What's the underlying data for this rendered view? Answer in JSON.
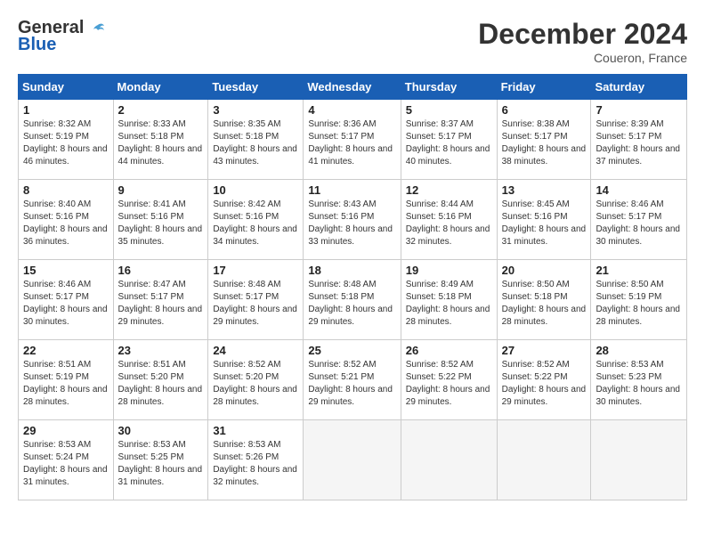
{
  "header": {
    "logo_line1": "General",
    "logo_line2": "Blue",
    "month_title": "December 2024",
    "location": "Coueron, France"
  },
  "days_of_week": [
    "Sunday",
    "Monday",
    "Tuesday",
    "Wednesday",
    "Thursday",
    "Friday",
    "Saturday"
  ],
  "weeks": [
    [
      {
        "day": "1",
        "sunrise": "8:32 AM",
        "sunset": "5:19 PM",
        "daylight": "8 hours and 46 minutes."
      },
      {
        "day": "2",
        "sunrise": "8:33 AM",
        "sunset": "5:18 PM",
        "daylight": "8 hours and 44 minutes."
      },
      {
        "day": "3",
        "sunrise": "8:35 AM",
        "sunset": "5:18 PM",
        "daylight": "8 hours and 43 minutes."
      },
      {
        "day": "4",
        "sunrise": "8:36 AM",
        "sunset": "5:17 PM",
        "daylight": "8 hours and 41 minutes."
      },
      {
        "day": "5",
        "sunrise": "8:37 AM",
        "sunset": "5:17 PM",
        "daylight": "8 hours and 40 minutes."
      },
      {
        "day": "6",
        "sunrise": "8:38 AM",
        "sunset": "5:17 PM",
        "daylight": "8 hours and 38 minutes."
      },
      {
        "day": "7",
        "sunrise": "8:39 AM",
        "sunset": "5:17 PM",
        "daylight": "8 hours and 37 minutes."
      }
    ],
    [
      {
        "day": "8",
        "sunrise": "8:40 AM",
        "sunset": "5:16 PM",
        "daylight": "8 hours and 36 minutes."
      },
      {
        "day": "9",
        "sunrise": "8:41 AM",
        "sunset": "5:16 PM",
        "daylight": "8 hours and 35 minutes."
      },
      {
        "day": "10",
        "sunrise": "8:42 AM",
        "sunset": "5:16 PM",
        "daylight": "8 hours and 34 minutes."
      },
      {
        "day": "11",
        "sunrise": "8:43 AM",
        "sunset": "5:16 PM",
        "daylight": "8 hours and 33 minutes."
      },
      {
        "day": "12",
        "sunrise": "8:44 AM",
        "sunset": "5:16 PM",
        "daylight": "8 hours and 32 minutes."
      },
      {
        "day": "13",
        "sunrise": "8:45 AM",
        "sunset": "5:16 PM",
        "daylight": "8 hours and 31 minutes."
      },
      {
        "day": "14",
        "sunrise": "8:46 AM",
        "sunset": "5:17 PM",
        "daylight": "8 hours and 30 minutes."
      }
    ],
    [
      {
        "day": "15",
        "sunrise": "8:46 AM",
        "sunset": "5:17 PM",
        "daylight": "8 hours and 30 minutes."
      },
      {
        "day": "16",
        "sunrise": "8:47 AM",
        "sunset": "5:17 PM",
        "daylight": "8 hours and 29 minutes."
      },
      {
        "day": "17",
        "sunrise": "8:48 AM",
        "sunset": "5:17 PM",
        "daylight": "8 hours and 29 minutes."
      },
      {
        "day": "18",
        "sunrise": "8:48 AM",
        "sunset": "5:18 PM",
        "daylight": "8 hours and 29 minutes."
      },
      {
        "day": "19",
        "sunrise": "8:49 AM",
        "sunset": "5:18 PM",
        "daylight": "8 hours and 28 minutes."
      },
      {
        "day": "20",
        "sunrise": "8:50 AM",
        "sunset": "5:18 PM",
        "daylight": "8 hours and 28 minutes."
      },
      {
        "day": "21",
        "sunrise": "8:50 AM",
        "sunset": "5:19 PM",
        "daylight": "8 hours and 28 minutes."
      }
    ],
    [
      {
        "day": "22",
        "sunrise": "8:51 AM",
        "sunset": "5:19 PM",
        "daylight": "8 hours and 28 minutes."
      },
      {
        "day": "23",
        "sunrise": "8:51 AM",
        "sunset": "5:20 PM",
        "daylight": "8 hours and 28 minutes."
      },
      {
        "day": "24",
        "sunrise": "8:52 AM",
        "sunset": "5:20 PM",
        "daylight": "8 hours and 28 minutes."
      },
      {
        "day": "25",
        "sunrise": "8:52 AM",
        "sunset": "5:21 PM",
        "daylight": "8 hours and 29 minutes."
      },
      {
        "day": "26",
        "sunrise": "8:52 AM",
        "sunset": "5:22 PM",
        "daylight": "8 hours and 29 minutes."
      },
      {
        "day": "27",
        "sunrise": "8:52 AM",
        "sunset": "5:22 PM",
        "daylight": "8 hours and 29 minutes."
      },
      {
        "day": "28",
        "sunrise": "8:53 AM",
        "sunset": "5:23 PM",
        "daylight": "8 hours and 30 minutes."
      }
    ],
    [
      {
        "day": "29",
        "sunrise": "8:53 AM",
        "sunset": "5:24 PM",
        "daylight": "8 hours and 31 minutes."
      },
      {
        "day": "30",
        "sunrise": "8:53 AM",
        "sunset": "5:25 PM",
        "daylight": "8 hours and 31 minutes."
      },
      {
        "day": "31",
        "sunrise": "8:53 AM",
        "sunset": "5:26 PM",
        "daylight": "8 hours and 32 minutes."
      },
      null,
      null,
      null,
      null
    ]
  ]
}
